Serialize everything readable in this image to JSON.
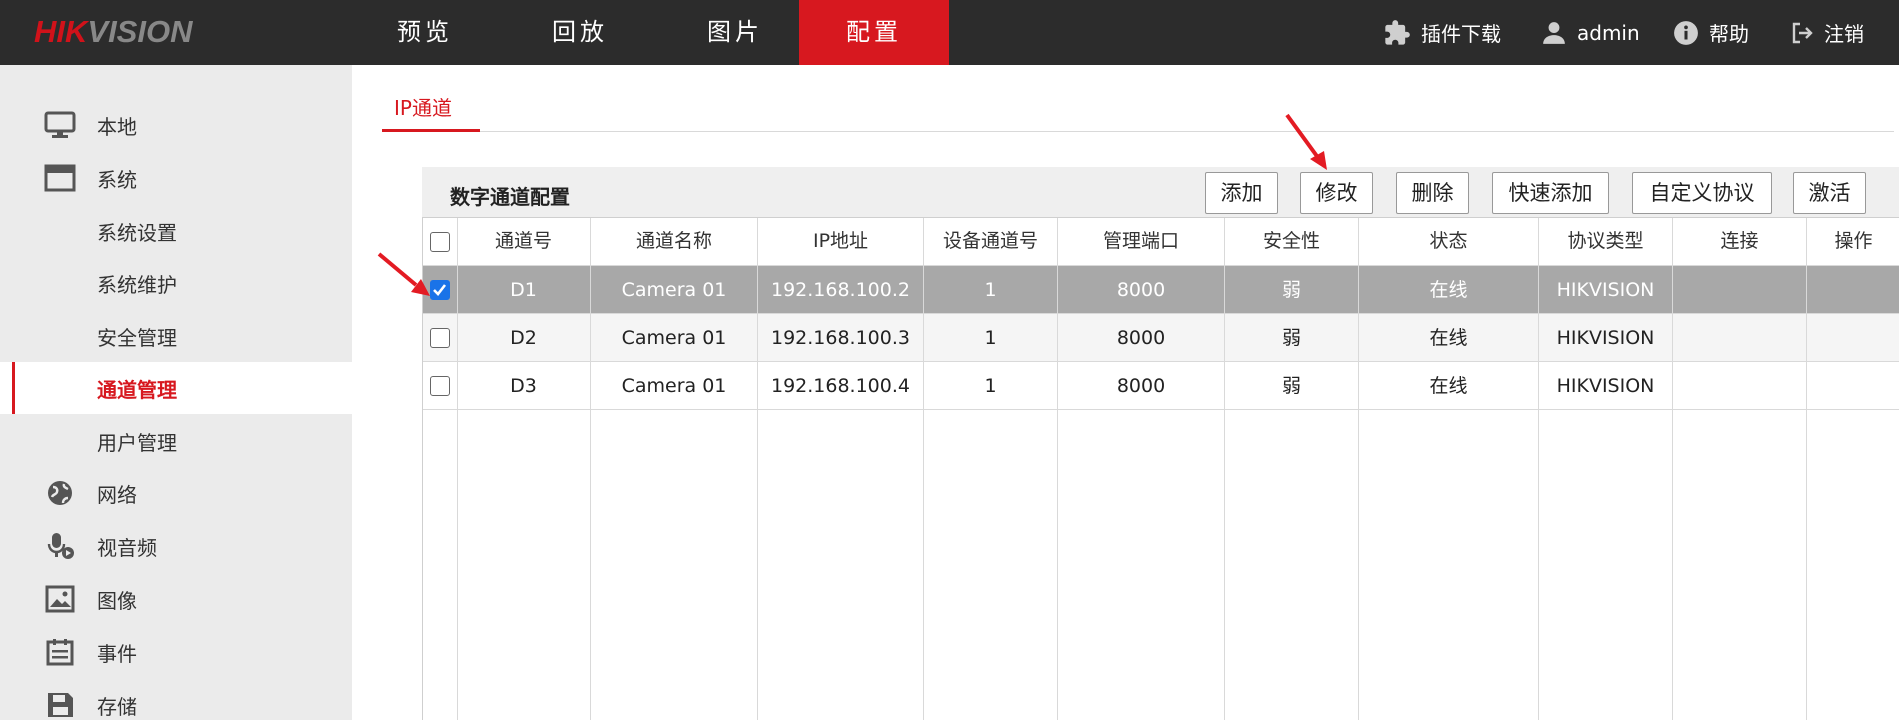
{
  "brand": {
    "part1": "HIK",
    "part2": "VISION"
  },
  "nav": {
    "tabs": [
      "预览",
      "回放",
      "图片",
      "配置"
    ],
    "active_index": 3
  },
  "top_right": {
    "plugin": "插件下载",
    "user": "admin",
    "help": "帮助",
    "logout": "注销"
  },
  "sidebar": {
    "items": [
      {
        "label": "本地",
        "icon": "monitor-icon"
      },
      {
        "label": "系统",
        "icon": "window-icon"
      },
      {
        "label": "系统设置",
        "icon": ""
      },
      {
        "label": "系统维护",
        "icon": ""
      },
      {
        "label": "安全管理",
        "icon": ""
      },
      {
        "label": "通道管理",
        "icon": "",
        "active": true
      },
      {
        "label": "用户管理",
        "icon": ""
      },
      {
        "label": "网络",
        "icon": "globe-icon"
      },
      {
        "label": "视音频",
        "icon": "microphone-icon"
      },
      {
        "label": "图像",
        "icon": "image-icon"
      },
      {
        "label": "事件",
        "icon": "calendar-icon"
      },
      {
        "label": "存储",
        "icon": "floppy-icon"
      }
    ]
  },
  "main": {
    "tab": "IP通道",
    "panel_title": "数字通道配置",
    "buttons": [
      "添加",
      "修改",
      "删除",
      "快速添加",
      "自定义协议",
      "激活"
    ],
    "columns": [
      "通道号",
      "通道名称",
      "IP地址",
      "设备通道号",
      "管理端口",
      "安全性",
      "状态",
      "协议类型",
      "连接",
      "操作"
    ],
    "rows": [
      {
        "checked": true,
        "cells": [
          "D1",
          "Camera 01",
          "192.168.100.2",
          "1",
          "8000",
          "弱",
          "在线",
          "HIKVISION",
          "",
          ""
        ]
      },
      {
        "checked": false,
        "cells": [
          "D2",
          "Camera 01",
          "192.168.100.3",
          "1",
          "8000",
          "弱",
          "在线",
          "HIKVISION",
          "",
          ""
        ]
      },
      {
        "checked": false,
        "cells": [
          "D3",
          "Camera 01",
          "192.168.100.4",
          "1",
          "8000",
          "弱",
          "在线",
          "HIKVISION",
          "",
          ""
        ]
      }
    ]
  },
  "colors": {
    "accent": "#d7181f",
    "topbar": "#2c2c2c",
    "sidebar": "#ebebeb",
    "selected_row": "#a8a8a8"
  }
}
